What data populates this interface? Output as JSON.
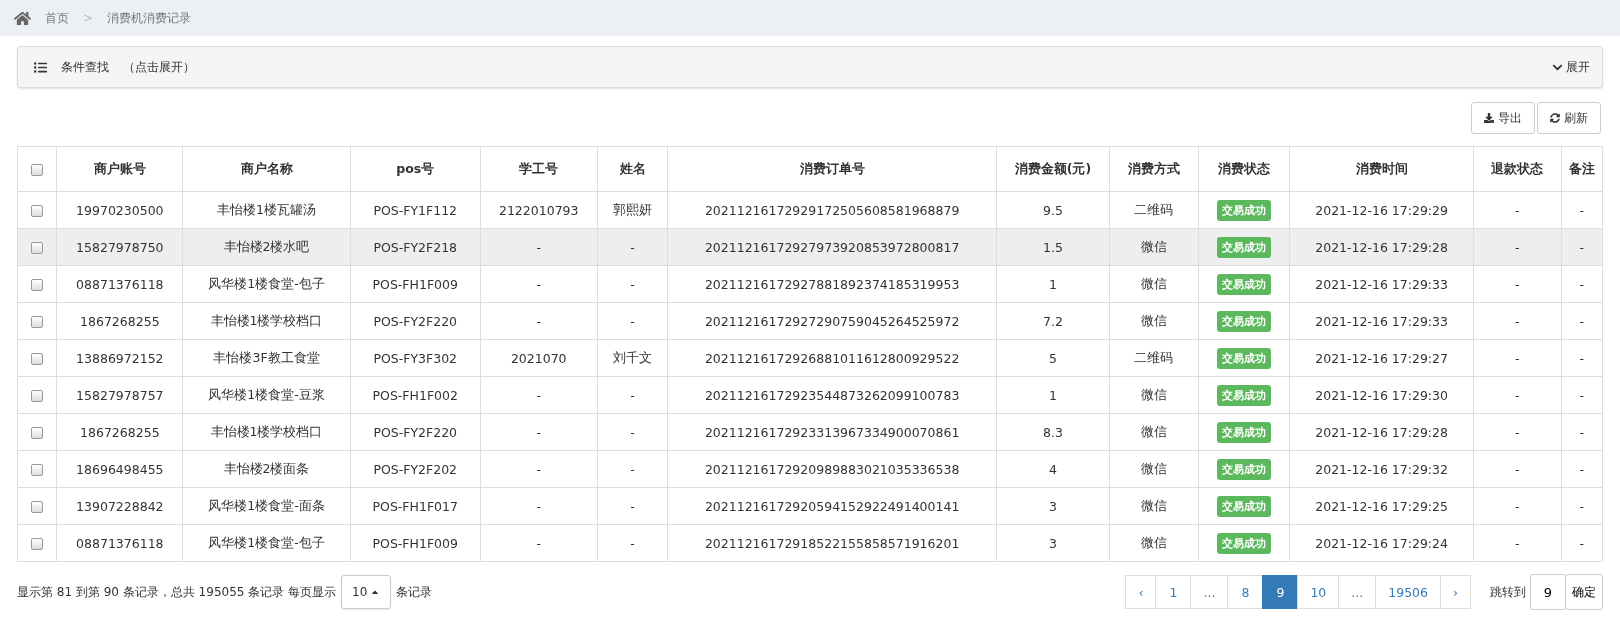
{
  "breadcrumb": {
    "items": [
      "首页",
      "消费机消费记录"
    ],
    "separator": ">"
  },
  "filter_panel": {
    "title": "条件查找",
    "hint": "（点击展开）",
    "toggle": "展开",
    "expanded": false
  },
  "toolbar": {
    "buttons": [
      {
        "kind": "export",
        "label": "导出"
      },
      {
        "kind": "refresh",
        "label": "刷新"
      }
    ]
  },
  "table": {
    "select_all_checked": false,
    "columns": [
      "商户账号",
      "商户名称",
      "pos号",
      "学工号",
      "姓名",
      "消费订单号",
      "消费金额(元)",
      "消费方式",
      "消费状态",
      "消费时间",
      "退款状态",
      "备注"
    ],
    "rows": [
      {
        "checked": false,
        "highlighted": false,
        "cells": [
          "19970230500",
          "丰怡楼1楼瓦罐汤",
          "POS-FY1F112",
          "2122010793",
          "郭熙妍",
          "20211216172929172505608581968879",
          "9.5",
          "二维码"
        ],
        "status": {
          "kind": "success",
          "label": "交易成功"
        },
        "time": "2021-12-16 17:29:29",
        "refund": "-",
        "remark": "-"
      },
      {
        "checked": false,
        "highlighted": true,
        "cells": [
          "15827978750",
          "丰怡楼2楼水吧",
          "POS-FY2F218",
          "-",
          "-",
          "20211216172927973920853972800817",
          "1.5",
          "微信"
        ],
        "status": {
          "kind": "success",
          "label": "交易成功"
        },
        "time": "2021-12-16 17:29:28",
        "refund": "-",
        "remark": "-"
      },
      {
        "checked": false,
        "highlighted": false,
        "cells": [
          "08871376118",
          "风华楼1楼食堂-包子",
          "POS-FH1F009",
          "-",
          "-",
          "20211216172927881892374185319953",
          "1",
          "微信"
        ],
        "status": {
          "kind": "success",
          "label": "交易成功"
        },
        "time": "2021-12-16 17:29:33",
        "refund": "-",
        "remark": "-"
      },
      {
        "checked": false,
        "highlighted": false,
        "cells": [
          "1867268255",
          "丰怡楼1楼学校档口",
          "POS-FY2F220",
          "-",
          "-",
          "20211216172927290759045264525972",
          "7.2",
          "微信"
        ],
        "status": {
          "kind": "success",
          "label": "交易成功"
        },
        "time": "2021-12-16 17:29:33",
        "refund": "-",
        "remark": "-"
      },
      {
        "checked": false,
        "highlighted": false,
        "cells": [
          "13886972152",
          "丰怡楼3F教工食堂",
          "POS-FY3F302",
          "2021070",
          "刘千文",
          "20211216172926881011612800929522",
          "5",
          "二维码"
        ],
        "status": {
          "kind": "success",
          "label": "交易成功"
        },
        "time": "2021-12-16 17:29:27",
        "refund": "-",
        "remark": "-"
      },
      {
        "checked": false,
        "highlighted": false,
        "cells": [
          "15827978757",
          "风华楼1楼食堂-豆浆",
          "POS-FH1F002",
          "-",
          "-",
          "20211216172923544873262099100783",
          "1",
          "微信"
        ],
        "status": {
          "kind": "success",
          "label": "交易成功"
        },
        "time": "2021-12-16 17:29:30",
        "refund": "-",
        "remark": "-"
      },
      {
        "checked": false,
        "highlighted": false,
        "cells": [
          "1867268255",
          "丰怡楼1楼学校档口",
          "POS-FY2F220",
          "-",
          "-",
          "20211216172923313967334900070861",
          "8.3",
          "微信"
        ],
        "status": {
          "kind": "success",
          "label": "交易成功"
        },
        "time": "2021-12-16 17:29:28",
        "refund": "-",
        "remark": "-"
      },
      {
        "checked": false,
        "highlighted": false,
        "cells": [
          "18696498455",
          "丰怡楼2楼面条",
          "POS-FY2F202",
          "-",
          "-",
          "20211216172920989883021035336538",
          "4",
          "微信"
        ],
        "status": {
          "kind": "success",
          "label": "交易成功"
        },
        "time": "2021-12-16 17:29:32",
        "refund": "-",
        "remark": "-"
      },
      {
        "checked": false,
        "highlighted": false,
        "cells": [
          "13907228842",
          "风华楼1楼食堂-面条",
          "POS-FH1F017",
          "-",
          "-",
          "20211216172920594152922491400141",
          "3",
          "微信"
        ],
        "status": {
          "kind": "success",
          "label": "交易成功"
        },
        "time": "2021-12-16 17:29:25",
        "refund": "-",
        "remark": "-"
      },
      {
        "checked": false,
        "highlighted": false,
        "cells": [
          "08871376118",
          "风华楼1楼食堂-包子",
          "POS-FH1F009",
          "-",
          "-",
          "20211216172918522155858571916201",
          "3",
          "微信"
        ],
        "status": {
          "kind": "success",
          "label": "交易成功"
        },
        "time": "2021-12-16 17:29:24",
        "refund": "-",
        "remark": "-"
      }
    ]
  },
  "footer": {
    "summary": "显示第 81 到第 90 条记录，总共 195055 条记录 每页显示",
    "page_size": "10",
    "page_size_suffix": "条记录",
    "pages": [
      {
        "kind": "prev",
        "label": "‹",
        "selected": false
      },
      {
        "kind": "page",
        "label": "1",
        "selected": false
      },
      {
        "kind": "ellipsis",
        "label": "...",
        "selected": false
      },
      {
        "kind": "page",
        "label": "8",
        "selected": false
      },
      {
        "kind": "page",
        "label": "9",
        "selected": true
      },
      {
        "kind": "page",
        "label": "10",
        "selected": false
      },
      {
        "kind": "ellipsis",
        "label": "...",
        "selected": false
      },
      {
        "kind": "page",
        "label": "19506",
        "selected": false
      },
      {
        "kind": "next",
        "label": "›",
        "selected": false
      }
    ],
    "jump_label": "跳转到",
    "jump_value": "9",
    "jump_button": "确定"
  }
}
